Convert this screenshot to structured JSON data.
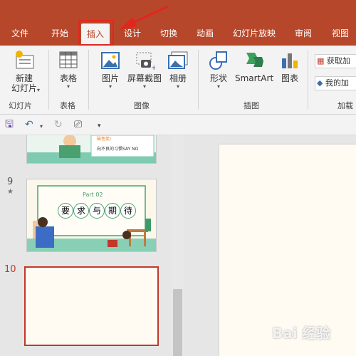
{
  "tabs": [
    "文件",
    "开始",
    "插入",
    "设计",
    "切换",
    "动画",
    "幻灯片放映",
    "审阅",
    "视图"
  ],
  "active_tab": "插入",
  "ribbon": {
    "new_slide_label": "新建\n幻灯片",
    "table_label": "表格",
    "pictures_label": "图片",
    "screenshot_label": "屏幕截图",
    "album_label": "相册",
    "shapes_label": "形状",
    "smartart_label": "SmartArt",
    "chart_label": "图表",
    "get_addins_label": "获取加",
    "my_addins_label": "我的加"
  },
  "groups": {
    "slides": "幻灯片",
    "tables": "表格",
    "images": "图像",
    "illustrations": "插图",
    "addins": "加载"
  },
  "slides": {
    "prev_slide_text1": "磁性笑!",
    "prev_slide_text2": "向不良的习惯SAY NO",
    "slide9_number": "9",
    "slide9_star": "★",
    "slide9_part": "Part 02",
    "slide9_chars": [
      "要",
      "求",
      "与",
      "期",
      "待"
    ],
    "slide10_number": "10"
  },
  "watermark": "Bai 经验",
  "colors": {
    "accent": "#b7472a",
    "highlight": "#e4251d",
    "active_slide_border": "#c0392b"
  }
}
